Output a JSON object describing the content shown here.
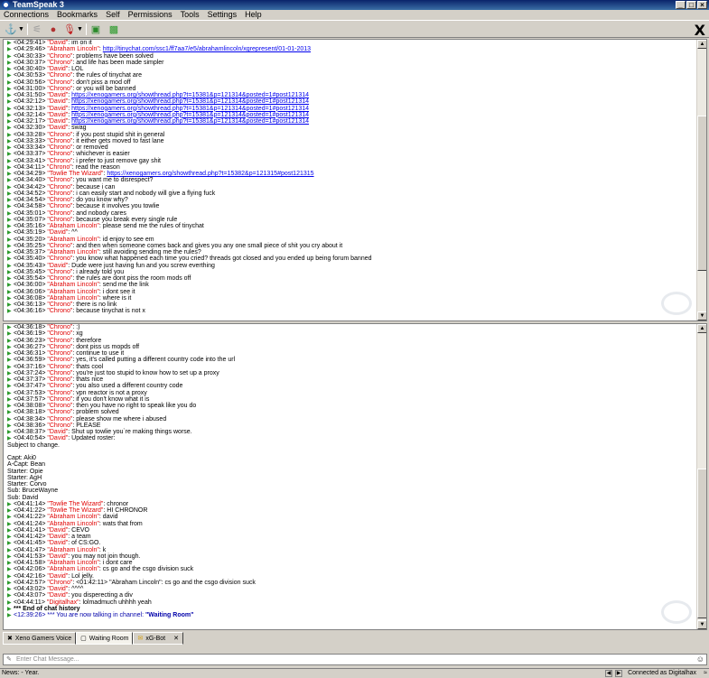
{
  "window": {
    "title": "TeamSpeak 3"
  },
  "menu": [
    "Connections",
    "Bookmarks",
    "Self",
    "Permissions",
    "Tools",
    "Settings",
    "Help"
  ],
  "top_chat": [
    {
      "t": "<04:29:41>",
      "n": "\"David\"",
      "m": ": im on it"
    },
    {
      "t": "<04:29:46>",
      "n": "\"Abraham Lincoln\"",
      "m": ": ",
      "l": "http://tinychat.com/ssc1/ff7aa7/e5/abrahamlincoln/xgrepresent/01-01-2013"
    },
    {
      "t": "<04:30:33>",
      "n": "\"Chrono\"",
      "m": ": problems have been solved"
    },
    {
      "t": "<04:30:37>",
      "n": "\"Chrono\"",
      "m": ": and life has been made simpler"
    },
    {
      "t": "<04:30:40>",
      "n": "\"David\"",
      "m": ": LOL"
    },
    {
      "t": "<04:30:53>",
      "n": "\"Chrono\"",
      "m": ": the rules of tinychat are"
    },
    {
      "t": "<04:30:56>",
      "n": "\"Chrono\"",
      "m": ": don't piss a mod off"
    },
    {
      "t": "<04:31:00>",
      "n": "\"Chrono\"",
      "m": ": or you will be banned"
    },
    {
      "t": "<04:31:50>",
      "n": "\"David\"",
      "m": ": ",
      "l": "https://xenogamers.org/showthread.php?t=15381&p=121314&posted=1#post121314"
    },
    {
      "t": "<04:32:12>",
      "n": "\"David\"",
      "m": ": ",
      "l": "https://xenogamers.org/showthread.php?t=15381&p=121314&posted=1#post121314"
    },
    {
      "t": "<04:32:13>",
      "n": "\"David\"",
      "m": ": ",
      "l": "https://xenogamers.org/showthread.php?t=15381&p=121314&posted=1#post121314"
    },
    {
      "t": "<04:32:14>",
      "n": "\"David\"",
      "m": ": ",
      "l": "https://xenogamers.org/showthread.php?t=15381&p=121314&posted=1#post121314"
    },
    {
      "t": "<04:32:17>",
      "n": "\"David\"",
      "m": ": ",
      "l": "https://xenogamers.org/showthread.php?t=15381&p=121314&posted=1#post121314"
    },
    {
      "t": "<04:32:30>",
      "n": "\"David\"",
      "m": ": swag"
    },
    {
      "t": "<04:33:28>",
      "n": "\"Chrono\"",
      "m": ": if you post stupid shit in general"
    },
    {
      "t": "<04:33:33>",
      "n": "\"Chrono\"",
      "m": ": it either gets moved to fast lane"
    },
    {
      "t": "<04:33:34>",
      "n": "\"Chrono\"",
      "m": ": or removed"
    },
    {
      "t": "<04:33:37>",
      "n": "\"Chrono\"",
      "m": ": whichever is easier"
    },
    {
      "t": "<04:33:41>",
      "n": "\"Chrono\"",
      "m": ": i prefer to just remove gay shit"
    },
    {
      "t": "<04:34:11>",
      "n": "\"Chrono\"",
      "m": ": read the reason"
    },
    {
      "t": "<04:34:29>",
      "n": "\"Towlie The Wizard\"",
      "m": ": ",
      "l": "https://xenogamers.org/showthread.php?t=15382&p=121315#post121315"
    },
    {
      "t": "<04:34:40>",
      "n": "\"Chrono\"",
      "m": ": you want me to disrespect?"
    },
    {
      "t": "<04:34:42>",
      "n": "\"Chrono\"",
      "m": ": because i can"
    },
    {
      "t": "<04:34:52>",
      "n": "\"Chrono\"",
      "m": ": i can easily start and nobody will give a flying fuck"
    },
    {
      "t": "<04:34:54>",
      "n": "\"Chrono\"",
      "m": ": do you know why?"
    },
    {
      "t": "<04:34:58>",
      "n": "\"Chrono\"",
      "m": ": because it involves you towlie"
    },
    {
      "t": "<04:35:01>",
      "n": "\"Chrono\"",
      "m": ": and nobody cares"
    },
    {
      "t": "<04:35:07>",
      "n": "\"Chrono\"",
      "m": ": because you break every single rule"
    },
    {
      "t": "<04:35:16>",
      "n": "\"Abraham Lincoln\"",
      "m": ": please send me the rules of tinychat"
    },
    {
      "t": "<04:35:19>",
      "n": "\"David\"",
      "m": ": ^^"
    },
    {
      "t": "<04:35:20>",
      "n": "\"Abraham Lincoln\"",
      "m": ": id enjoy to see em"
    },
    {
      "t": "<04:35:25>",
      "n": "\"Chrono\"",
      "m": ": and then when someone comes back and gives you any one small piece of shit you cry about it"
    },
    {
      "t": "<04:35:37>",
      "n": "\"Abraham Lincoln\"",
      "m": ": still avoiding sending me the rules?"
    },
    {
      "t": "<04:35:40>",
      "n": "\"Chrono\"",
      "m": ": you know what happened each time you cried? threads got closed and you ended up being forum banned"
    },
    {
      "t": "<04:35:43>",
      "n": "\"David\"",
      "m": ": Dude were just having fun and you screw everthing"
    },
    {
      "t": "<04:35:45>",
      "n": "\"Chrono\"",
      "m": ": i already told you"
    },
    {
      "t": "<04:35:54>",
      "n": "\"Chrono\"",
      "m": ": the rules are dont piss the room mods off"
    },
    {
      "t": "<04:36:00>",
      "n": "\"Abraham Lincoln\"",
      "m": ": send me the link"
    },
    {
      "t": "<04:36:06>",
      "n": "\"Abraham Lincoln\"",
      "m": ": i dont see it"
    },
    {
      "t": "<04:36:08>",
      "n": "\"Abraham Lincoln\"",
      "m": ": where is it"
    },
    {
      "t": "<04:36:13>",
      "n": "\"Chrono\"",
      "m": ": there is no link"
    },
    {
      "t": "<04:36:16>",
      "n": "\"Chrono\"",
      "m": ": because tinychat is not x"
    }
  ],
  "bottom_chat": [
    {
      "t": "<04:36:18>",
      "n": "\"Chrono\"",
      "m": ": :)"
    },
    {
      "t": "<04:36:19>",
      "n": "\"Chrono\"",
      "m": ": xg"
    },
    {
      "t": "<04:36:23>",
      "n": "\"Chrono\"",
      "m": ": therefore"
    },
    {
      "t": "<04:36:27>",
      "n": "\"Chrono\"",
      "m": ": dont piss us mopds off"
    },
    {
      "t": "<04:36:31>",
      "n": "\"Chrono\"",
      "m": ": continue to use it"
    },
    {
      "t": "<04:36:59>",
      "n": "\"Chrono\"",
      "m": ": yes, it's called putting a different country code into the url"
    },
    {
      "t": "<04:37:16>",
      "n": "\"Chrono\"",
      "m": ": thats cool"
    },
    {
      "t": "<04:37:24>",
      "n": "\"Chrono\"",
      "m": ": you're just too stupid to know how to set up a proxy"
    },
    {
      "t": "<04:37:37>",
      "n": "\"Chrono\"",
      "m": ": thats nice"
    },
    {
      "t": "<04:37:47>",
      "n": "\"Chrono\"",
      "m": ": you also used a different country code"
    },
    {
      "t": "<04:37:53>",
      "n": "\"Chrono\"",
      "m": ": vpn reactor is not a proxy"
    },
    {
      "t": "<04:37:57>",
      "n": "\"Chrono\"",
      "m": ": if you don't know what it is"
    },
    {
      "t": "<04:38:08>",
      "n": "\"Chrono\"",
      "m": ": then you have no right to speak like you do"
    },
    {
      "t": "<04:38:18>",
      "n": "\"Chrono\"",
      "m": ": problem solved"
    },
    {
      "t": "<04:38:34>",
      "n": "\"Chrono\"",
      "m": ": please show me where i abused"
    },
    {
      "t": "<04:38:36>",
      "n": "\"Chrono\"",
      "m": ": PLEASE"
    },
    {
      "t": "<04:38:37>",
      "n": "\"David\"",
      "m": ": Shut up towlie you`re making things worse."
    },
    {
      "t": "<04:40:54>",
      "n": "\"David\"",
      "m": ": Updated roster:"
    },
    {
      "p": "Subject to change."
    },
    {
      "p": ""
    },
    {
      "p": "Capt: Aki0"
    },
    {
      "p": "A-Capt: Bean"
    },
    {
      "p": "Starter: Opie"
    },
    {
      "p": "Starter: AgH"
    },
    {
      "p": "Starter: Corvo"
    },
    {
      "p": "Sub: BruceWayne"
    },
    {
      "p": "Sub: David"
    },
    {
      "t": "<04:41:14>",
      "n": "\"Towlie The Wizard\"",
      "m": ": chronor"
    },
    {
      "t": "<04:41:22>",
      "n": "\"Towlie The Wizard\"",
      "m": ": HI CHRONOR"
    },
    {
      "t": "<04:41:22>",
      "n": "\"Abraham Lincoln\"",
      "m": ": david"
    },
    {
      "t": "<04:41:24>",
      "n": "\"Abraham Lincoln\"",
      "m": ": wats that from"
    },
    {
      "t": "<04:41:41>",
      "n": "\"David\"",
      "m": ": CEVO"
    },
    {
      "t": "<04:41:42>",
      "n": "\"David\"",
      "m": ": a team"
    },
    {
      "t": "<04:41:45>",
      "n": "\"David\"",
      "m": ": of CS:GO."
    },
    {
      "t": "<04:41:47>",
      "n": "\"Abraham Lincoln\"",
      "m": ": k"
    },
    {
      "t": "<04:41:53>",
      "n": "\"David\"",
      "m": ": you may not join though."
    },
    {
      "t": "<04:41:58>",
      "n": "\"Abraham Lincoln\"",
      "m": ": i dont care"
    },
    {
      "t": "<04:42:06>",
      "n": "\"Abraham Lincoln\"",
      "m": ": cs go and the csgo division suck"
    },
    {
      "t": "<04:42:16>",
      "n": "\"David\"",
      "m": ": Lol jelly."
    },
    {
      "t": "<04:42:57>",
      "n": "\"Chrono\"",
      "m": ": <01:42:11> \"Abraham Lincoln\": cs go and the csgo division suck"
    },
    {
      "t": "<04:43:02>",
      "n": "\"David\"",
      "m": ": ^^^^"
    },
    {
      "t": "<04:43:07>",
      "n": "\"David\"",
      "m": ": you disperecting a div"
    },
    {
      "t": "<04:44:11>",
      "n": "\"Digitalhax\"",
      "m": ": lolmadmuch uhhhh yeah"
    },
    {
      "b": "*** End of chat history"
    },
    {
      "t": "<12:39:26>",
      "s": "*** You are now talking in channel: ",
      "sb": "\"Waiting Room\""
    }
  ],
  "tabs": [
    {
      "label": "Xeno Gamers Voice",
      "icon": "server-icon"
    },
    {
      "label": "Waiting Room",
      "icon": "channel-icon"
    },
    {
      "label": "xG-Bot",
      "icon": "private-chat-icon"
    }
  ],
  "input": {
    "placeholder": "Enter Chat Message..."
  },
  "status": {
    "news": "News: - Year.",
    "connection": "Connected as Digitalhax"
  }
}
